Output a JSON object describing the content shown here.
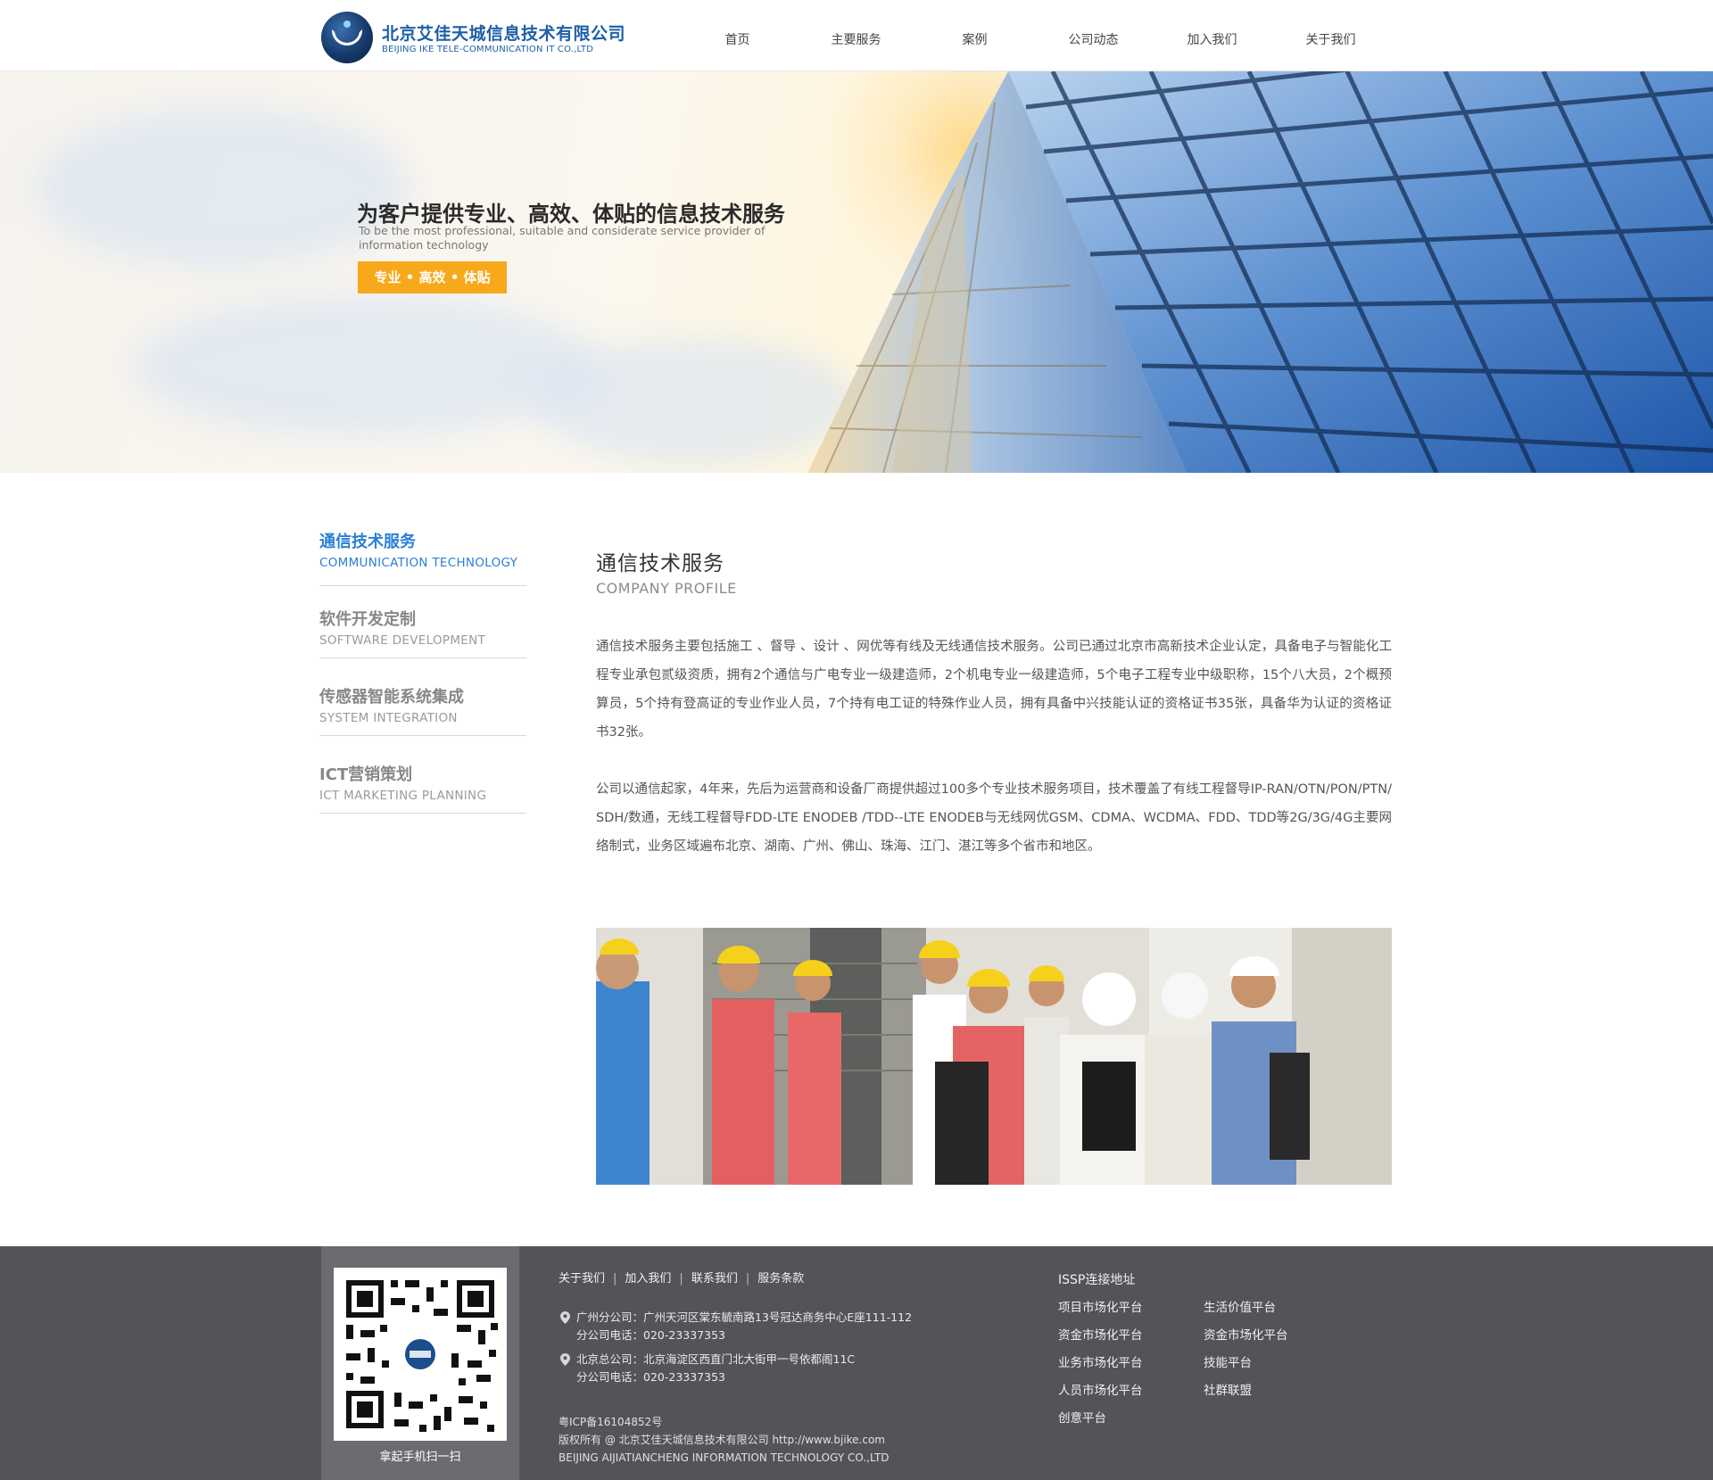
{
  "header": {
    "logo_cn": "北京艾佳天城信息技术有限公司",
    "logo_en": "BEIJING IKE TELE-COMMUNICATION IT CO.,LTD",
    "nav": [
      "首页",
      "主要服务",
      "案例",
      "公司动态",
      "加入我们",
      "关于我们"
    ]
  },
  "banner": {
    "title": "为客户提供专业、高效、体贴的信息技术服务",
    "subtitle": "To be the most professional, suitable and considerate service provider of information technology",
    "button": "专业 • 高效 • 体贴"
  },
  "sidebar": {
    "items": [
      {
        "cn": "通信技术服务",
        "en": "COMMUNICATION TECHNOLOGY",
        "active": true
      },
      {
        "cn": "软件开发定制",
        "en": "SOFTWARE DEVELOPMENT",
        "active": false
      },
      {
        "cn": "传感器智能系统集成",
        "en": "SYSTEM INTEGRATION",
        "active": false
      },
      {
        "cn": "ICT营销策划",
        "en": "ICT MARKETING PLANNING",
        "active": false
      }
    ]
  },
  "main": {
    "title": "通信技术服务",
    "subtitle": "COMPANY PROFILE",
    "paragraphs": [
      "通信技术服务主要包括施工 、督导 、设计 、网优等有线及无线通信技术服务。公司已通过北京市高新技术企业认定，具备电子与智能化工程专业承包贰级资质，拥有2个通信与广电专业一级建造师，2个机电专业一级建造师，5个电子工程专业中级职称，15个八大员，2个概预算员，5个持有登高证的专业作业人员，7个持有电工证的特殊作业人员，拥有具备中兴技能认证的资格证书35张，具备华为认证的资格证书32张。",
      "公司以通信起家，4年来，先后为运营商和设备厂商提供超过100多个专业技术服务项目，技术覆盖了有线工程督导IP-RAN/OTN/PON/PTN/SDH/数通，无线工程督导FDD-LTE ENODEB /TDD--LTE ENODEB与无线网优GSM、CDMA、WCDMA、FDD、TDD等2G/3G/4G主要网络制式，业务区域遍布北京、湖南、广州、佛山、珠海、江门、湛江等多个省市和地区。"
    ]
  },
  "footer": {
    "qr_caption": "拿起手机扫一扫",
    "links": [
      "关于我们",
      "加入我们",
      "联系我们",
      "服务条款"
    ],
    "address1": {
      "line1": "广州分公司：广州天河区棠东毓南路13号冠达商务中心E座111-112",
      "line2": "分公司电话：020-23337353"
    },
    "address2": {
      "line1": "北京总公司：北京海淀区西直门北大街甲一号依都阁11C",
      "line2": "分公司电话：020-23337353"
    },
    "icp": "粤ICP备16104852号",
    "copyright": "版权所有 @ 北京艾佳天城信息技术有限公司 http://www.bjike.com",
    "company_en": "BEIJING AIJIATIANCHENG INFORMATION TECHNOLOGY CO.,LTD",
    "issp_title": "ISSP连接地址",
    "issp_links": [
      "项目市场化平台",
      "生活价值平台",
      "资金市场化平台",
      "资金市场化平台",
      "业务市场化平台",
      "技能平台",
      "人员市场化平台",
      "社群联盟",
      "创意平台"
    ]
  },
  "colors": {
    "accent": "#2a7fd6",
    "banner_button": "#f7a91b",
    "footer_bg": "#535459",
    "qr_panel_bg": "#6b6c72"
  }
}
